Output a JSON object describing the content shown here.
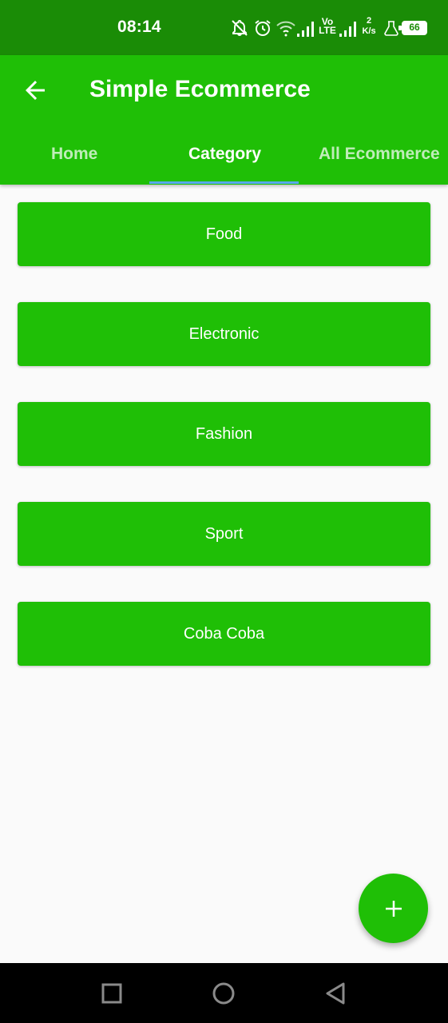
{
  "status_bar": {
    "time": "08:14",
    "network_top": "Vo",
    "network_bottom": "LTE",
    "speed_value": "2",
    "speed_unit": "K/s",
    "battery": "66",
    "icons": [
      "notifications-off-icon",
      "alarm-icon",
      "wifi-icon",
      "signal-icon",
      "volte-icon",
      "signal-icon",
      "data-speed-icon",
      "flask-icon",
      "battery-icon"
    ]
  },
  "app_bar": {
    "title": "Simple Ecommerce",
    "back_icon": "arrow-back-icon"
  },
  "tabs": [
    {
      "label": "Home",
      "active": false
    },
    {
      "label": "Category",
      "active": true
    },
    {
      "label": "All Ecommerce",
      "active": false
    }
  ],
  "categories": [
    {
      "label": "Food"
    },
    {
      "label": "Electronic"
    },
    {
      "label": "Fashion"
    },
    {
      "label": "Sport"
    },
    {
      "label": "Coba Coba"
    }
  ],
  "fab": {
    "icon": "plus-icon"
  },
  "nav_bar": {
    "icons": [
      "recent-apps-icon",
      "home-icon",
      "back-icon"
    ]
  },
  "colors": {
    "status_bar": "#1a8c06",
    "primary": "#1fbf06",
    "tab_indicator": "#5aa9f0",
    "background": "#fafafa"
  }
}
